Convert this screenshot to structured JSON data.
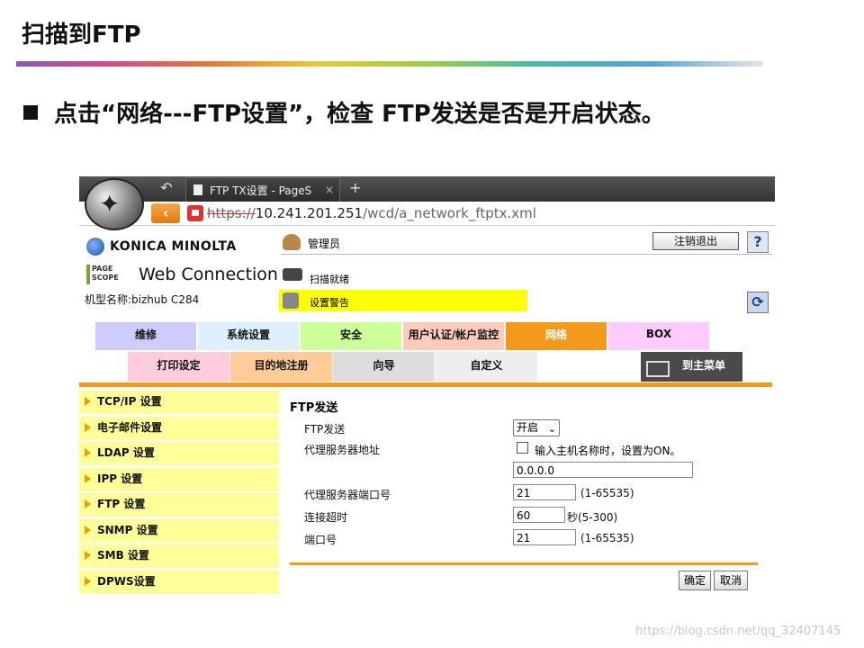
{
  "slide": {
    "title": "扫描到FTP",
    "bullet_text": "点击“网络---FTP设置”，检查 FTP发送是否是开启状态。"
  },
  "browser": {
    "tab_title": "FTP TX设置 - PageS",
    "tab_close": "×",
    "new_tab": "+",
    "back_top": "↶",
    "nav_back": "‹",
    "url_scheme": "https://",
    "url_host": "10.241.201.251",
    "url_path": "/wcd/a_network_ftptx.xml"
  },
  "header": {
    "brand": "KONICA MINOLTA",
    "pagescope_line1": "PAGE",
    "pagescope_line2": "SCOPE",
    "product": "Web Connection",
    "model": "机型名称:bizhub C284",
    "user": "管理员",
    "logout": "注销退出",
    "help": "?",
    "scan_status": "扫描就绪",
    "warning": "设置警告",
    "refresh": "⟳"
  },
  "menu": {
    "row1": [
      "维修",
      "系统设置",
      "安全",
      "用户认证/帐户监控",
      "网络",
      "BOX"
    ],
    "row2": [
      "打印设定",
      "目的地注册",
      "向导",
      "自定义"
    ],
    "to_main": "到主菜单"
  },
  "sidebar": {
    "items": [
      "TCP/IP 设置",
      "电子邮件设置",
      "LDAP 设置",
      "IPP 设置",
      "FTP 设置",
      "SNMP 设置",
      "SMB 设置",
      "DPWS设置"
    ]
  },
  "form": {
    "title": "FTP发送",
    "ftp_send_label": "FTP发送",
    "ftp_send_value": "开启",
    "proxy_address_label": "代理服务器地址",
    "proxy_checkbox_label": "输入主机名称时，设置为ON。",
    "proxy_address_value": "0.0.0.0",
    "proxy_port_label": "代理服务器端口号",
    "proxy_port_value": "21",
    "proxy_port_hint": "(1-65535)",
    "timeout_label": "连接超时",
    "timeout_value": "60",
    "timeout_hint": "秒(5-300)",
    "port_label": "端口号",
    "port_value": "21",
    "port_hint": "(1-65535)",
    "ok": "确定",
    "cancel": "取消"
  },
  "colors": {
    "tab_colors": [
      "#ccccff",
      "#ddeeff",
      "#ccff99",
      "#ffccbb",
      "#f39a1d",
      "#ffccff"
    ],
    "row2_colors": [
      "#ffccdd",
      "#ffcc99",
      "#dddddd",
      "#eeeeee"
    ],
    "accent_orange": "#f39a1d",
    "sidebar_yellow": "#ffff99"
  },
  "watermark": "https://blog.csdn.net/qq_32407145"
}
